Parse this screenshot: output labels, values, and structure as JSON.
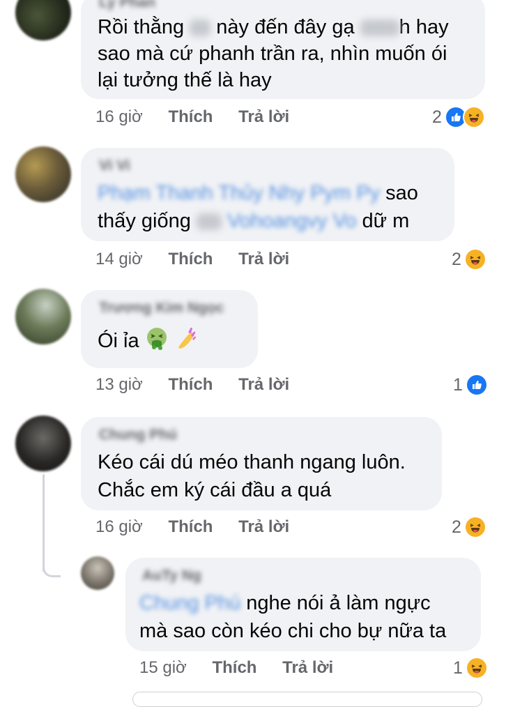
{
  "comments": [
    {
      "name": "Ly Phan",
      "lines": [
        "Rồi thằng",
        "này đến đây gạ",
        "h hay",
        "sao mà cứ phanh trần ra, nhìn muốn ói",
        "lại tưởng thế là hay"
      ],
      "time": "16 giờ",
      "like": "Thích",
      "reply": "Trả lời",
      "reaction_count": "2",
      "reactions": [
        "like-icon",
        "haha-icon"
      ]
    },
    {
      "name": "Vi Vi",
      "tag1": "Phạm Thanh Thủy Nhy Pym Py",
      "lines": [
        "sao",
        "thấy giống",
        "dữ m"
      ],
      "tag2": "Vohoangvy Vo",
      "time": "14 giờ",
      "like": "Thích",
      "reply": "Trả lời",
      "reaction_count": "2",
      "reactions": [
        "haha-icon"
      ]
    },
    {
      "name": "Trương Kim Ngọc",
      "lines": [
        "Ói ỉa"
      ],
      "time": "13 giờ",
      "like": "Thích",
      "reply": "Trả lời",
      "reaction_count": "1",
      "reactions": [
        "like-icon"
      ]
    },
    {
      "name": "Chung Phú",
      "lines": [
        "Kéo cái dú méo thanh ngang luôn.",
        "Chắc em ký cái đầu a quá"
      ],
      "time": "16 giờ",
      "like": "Thích",
      "reply": "Trả lời",
      "reaction_count": "2",
      "reactions": [
        "haha-icon"
      ]
    },
    {
      "name": "AuTy Ng",
      "tag1": "Chung Phú",
      "lines": [
        "nghe nói ả làm ngực",
        "mà sao còn kéo chi cho bự nữa ta"
      ],
      "time": "15 giờ",
      "like": "Thích",
      "reply": "Trả lời",
      "reaction_count": "1",
      "reactions": [
        "haha-icon"
      ]
    }
  ],
  "colors": {
    "bubble": "#f0f2f5",
    "meta_text": "#65676b",
    "tag": "#216fdb",
    "like": "#1877f2",
    "haha": "#f7b125"
  }
}
